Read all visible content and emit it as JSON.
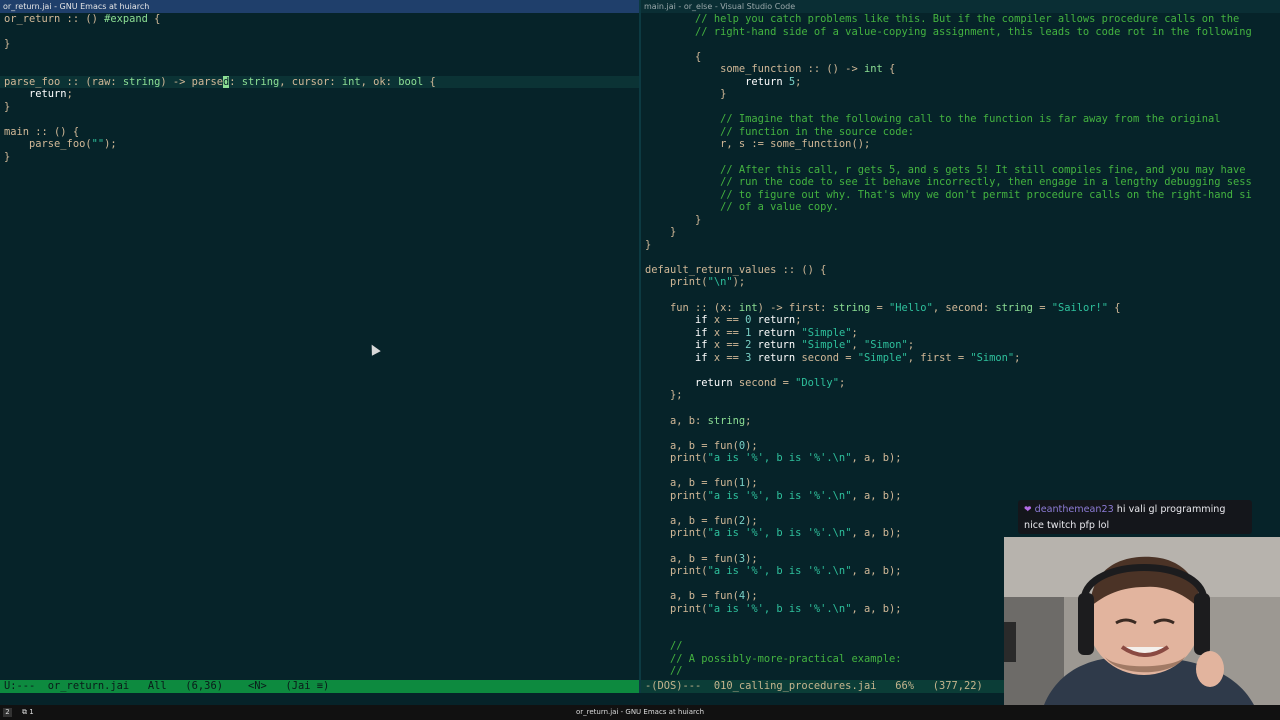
{
  "left": {
    "title": "or_return.jai - GNU Emacs at huiarch",
    "modeline": "U:---  or_return.jai   All   (6,36)    <N>   (Jai ≡)"
  },
  "right": {
    "title": "main.jai - or_else - Visual Studio Code",
    "modeline": "-(DOS)---  010_calling_procedures.jai   66%   (377,22)"
  },
  "taskbar": {
    "workspace": "2",
    "window_count": "1",
    "center_title": "or_return.jai - GNU Emacs at huiarch"
  },
  "chat": {
    "username": "deanthemean23",
    "message": "hi vali gl programming nice twitch pfp lol"
  }
}
